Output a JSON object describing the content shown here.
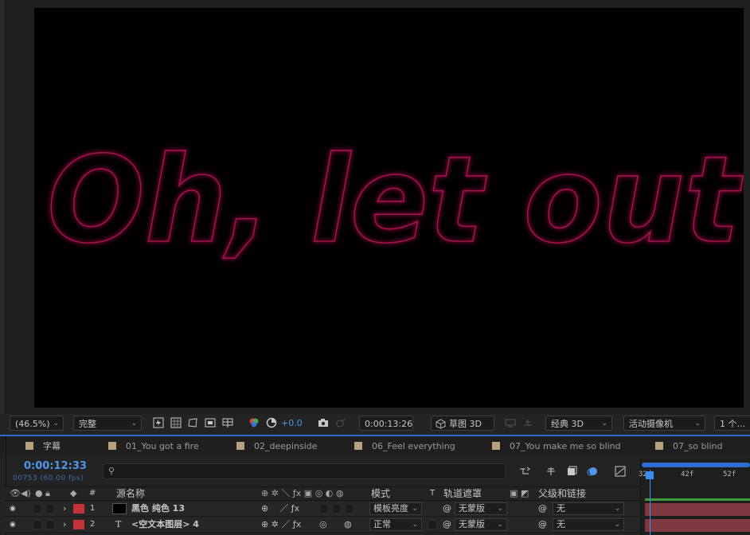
{
  "composition": {
    "text": "Oh, let out",
    "glow_color": "#c2185b",
    "background": "#020001"
  },
  "viewer_toolbar": {
    "zoom": "(46.5%)",
    "resolution": "完整",
    "exposure": "+0.0",
    "timecode": "0:00:13:26",
    "draft3d": "草图 3D",
    "renderer": "经典 3D",
    "camera": "活动摄像机",
    "views": "1 个..."
  },
  "tabs": [
    {
      "label": "字幕"
    },
    {
      "label": "01_You got a fire"
    },
    {
      "label": "02_deepinside"
    },
    {
      "label": "06_Feel everything"
    },
    {
      "label": "07_You make me so blind"
    },
    {
      "label": "07_so blind"
    }
  ],
  "timeline": {
    "current_time": "0:00:12:33",
    "frame_info": "00753 (60.00 fps)",
    "search_placeholder": "",
    "headers": {
      "number": "#",
      "source_name": "源名称",
      "mode": "模式",
      "t": "T",
      "track_matte": "轨道遮罩",
      "parent": "父级和链接"
    },
    "ruler": [
      "32",
      "42f",
      "52f"
    ],
    "layers": [
      {
        "index": "1",
        "type_icon": "■",
        "name": "黑色 纯色 13",
        "mode": "模板亮度",
        "matte": "无蒙版",
        "parent": "无",
        "label_color": "#c1343a"
      },
      {
        "index": "2",
        "type_icon": "T",
        "name": "<空文本图层> 4",
        "mode": "正常",
        "matte": "无蒙版",
        "parent": "无",
        "label_color": "#c1343a"
      }
    ]
  }
}
